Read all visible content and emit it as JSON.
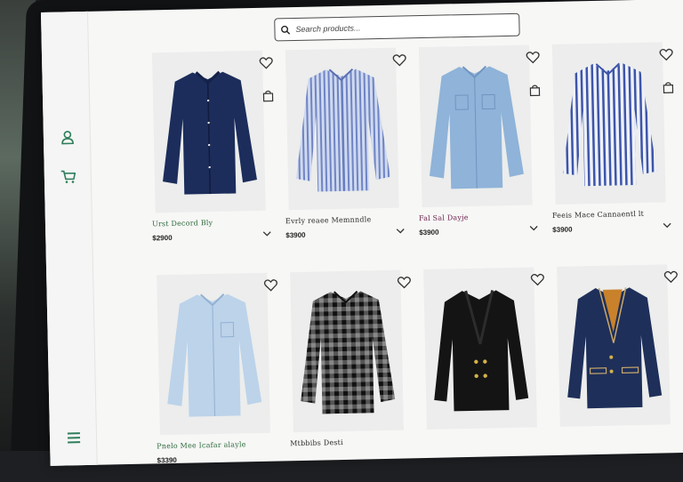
{
  "search": {
    "placeholder": "Search products..."
  },
  "sidebar": {
    "icons": [
      "user-icon",
      "cart-icon",
      "menu-icon"
    ]
  },
  "products": [
    {
      "name": "Urst Decord Bly",
      "price": "$2900",
      "name_color": "#2e6b3c"
    },
    {
      "name": "Evrly reaee Memnndle",
      "price": "$3900",
      "name_color": "#2a2a2a"
    },
    {
      "name": "Fal Sal Dayje",
      "price": "$3900",
      "name_color": "#6a1f4a"
    },
    {
      "name": "Feeis Mace Cannaentl lt",
      "price": "$3900",
      "name_color": "#2a2a2a"
    },
    {
      "name": "Pnelo Mee Icafar alayle",
      "price": "$3390",
      "name_color": "#2e6b3c"
    },
    {
      "name": "Mtbbibs Desti",
      "price": "",
      "name_color": "#2a2a2a"
    },
    {
      "name": "",
      "price": "",
      "name_color": "#2a2a2a"
    },
    {
      "name": "",
      "price": "",
      "name_color": "#2a2a2a"
    }
  ],
  "colors": {
    "accent": "#2e7d5b",
    "icon": "#333333"
  }
}
